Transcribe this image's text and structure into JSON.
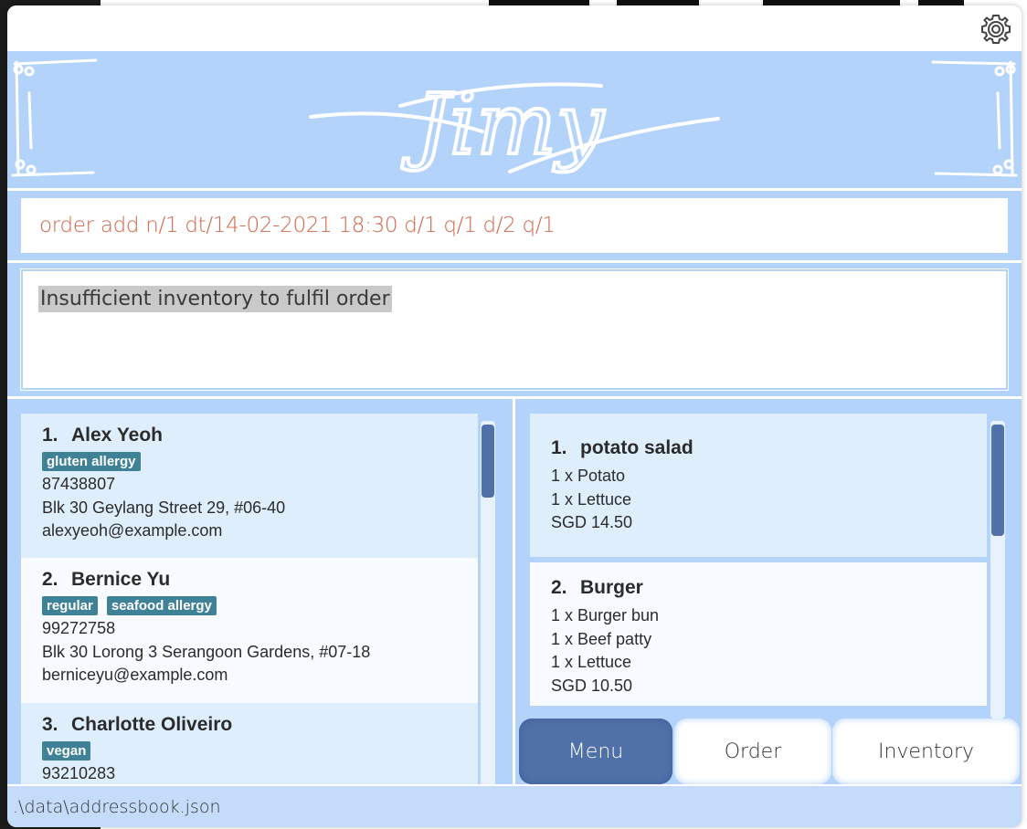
{
  "app": {
    "logo_text": "Jimy",
    "settings_icon": "gear-icon"
  },
  "command": {
    "value": "order add n/1 dt/14-02-2021 18:30 d/1 q/1 d/2 q/1"
  },
  "result": {
    "message": "Insufficient inventory to fulfil order"
  },
  "persons": [
    {
      "index": "1.",
      "name": "Alex Yeoh",
      "tags": [
        "gluten allergy"
      ],
      "phone": "87438807",
      "address": "Blk 30 Geylang Street 29, #06-40",
      "email": "alexyeoh@example.com"
    },
    {
      "index": "2.",
      "name": "Bernice Yu",
      "tags": [
        "regular",
        "seafood allergy"
      ],
      "phone": "99272758",
      "address": "Blk 30 Lorong 3 Serangoon Gardens, #07-18",
      "email": "berniceyu@example.com"
    },
    {
      "index": "3.",
      "name": "Charlotte Oliveiro",
      "tags": [
        "vegan"
      ],
      "phone": "93210283"
    }
  ],
  "menu_items": [
    {
      "index": "1.",
      "name": "potato salad",
      "ingredients": [
        "1 x Potato",
        "1 x Lettuce"
      ],
      "price": "SGD 14.50"
    },
    {
      "index": "2.",
      "name": "Burger",
      "ingredients": [
        "1 x Burger bun",
        "1 x Beef patty",
        "1 x Lettuce"
      ],
      "price": "SGD 10.50"
    }
  ],
  "tabs": [
    {
      "label": "Menu",
      "active": true
    },
    {
      "label": "Order",
      "active": false
    },
    {
      "label": "Inventory",
      "active": false
    }
  ],
  "status": {
    "path": ".\\data\\addressbook.json"
  },
  "colors": {
    "accent": "#5070a8",
    "banner": "#b3d3fb",
    "tag": "#3f8196",
    "command_text": "#d2664a"
  }
}
